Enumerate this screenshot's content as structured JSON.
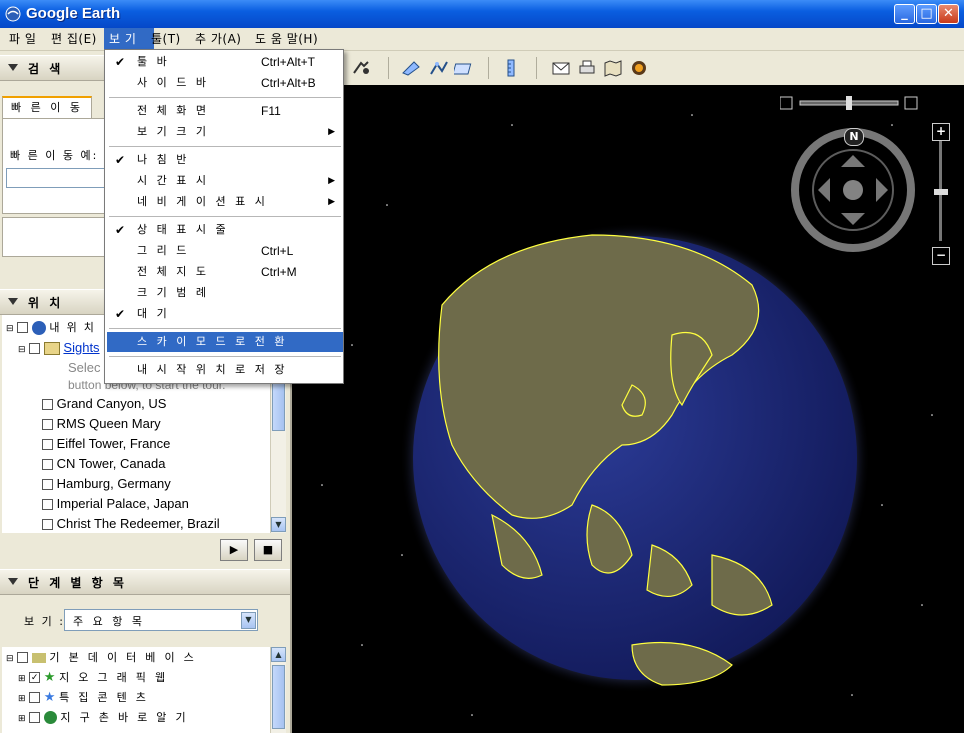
{
  "window": {
    "title": "Google Earth"
  },
  "menubar": {
    "items": [
      "파 일",
      "편 집(E)",
      "보 기",
      "툴(T)",
      "추 가(A)",
      "도 움 말(H)"
    ]
  },
  "view_menu": {
    "items": [
      {
        "label": "툴 바",
        "checked": "✔",
        "shortcut": "Ctrl+Alt+T"
      },
      {
        "label": "사 이 드 바",
        "checked": "",
        "shortcut": "Ctrl+Alt+B"
      },
      {
        "label": "전 체 화 면",
        "checked": "",
        "shortcut": "F11"
      },
      {
        "label": "보 기 크 기",
        "checked": "",
        "submenu": "▶"
      },
      {
        "label": "나 침 반",
        "checked": "✔",
        "shortcut": ""
      },
      {
        "label": "시 간 표 시",
        "checked": "",
        "submenu": "▶"
      },
      {
        "label": "네 비 게 이 션 표 시",
        "checked": "",
        "submenu": "▶"
      },
      {
        "label": "상 태 표 시 줄",
        "checked": "✔",
        "shortcut": ""
      },
      {
        "label": "그 리 드",
        "checked": "",
        "shortcut": "Ctrl+L"
      },
      {
        "label": "전 체 지 도",
        "checked": "",
        "shortcut": "Ctrl+M"
      },
      {
        "label": "크 기 범 례",
        "checked": "",
        "shortcut": ""
      },
      {
        "label": "대 기",
        "checked": "✔",
        "shortcut": ""
      },
      {
        "label": "스 카 이 모 드 로 전 환",
        "checked": "",
        "shortcut": ""
      },
      {
        "label": "내 시 작 위 치 로 저 장",
        "checked": "",
        "shortcut": ""
      }
    ]
  },
  "search_panel": {
    "header": "검 색",
    "tab_label": "빠 른 이 동",
    "prompt": "빠 른 이 동 예: 3"
  },
  "places_panel": {
    "header": "위 치",
    "my_places": "내 위 치",
    "sightseeing": "Sights",
    "desc_line1": "Selec",
    "desc_line2": "button below, to start the tour.",
    "items": [
      "Grand Canyon, US",
      "RMS Queen Mary",
      "Eiffel Tower, France",
      "CN Tower, Canada",
      "Hamburg, Germany",
      "Imperial Palace, Japan",
      "Christ The Redeemer, Brazil"
    ],
    "play_icon": "play-icon",
    "stop_icon": "stop-icon"
  },
  "layers_panel": {
    "header": "단 계 별 항 목",
    "view_label": "보 기 :",
    "view_select": "주 요 항 목",
    "items": [
      "기 본 데 이 터 베 이 스",
      "지 오 그 래 픽 웹",
      "특 집 콘 텐 츠",
      "지 구 촌 바 로 알 기"
    ]
  },
  "nav": {
    "north": "N",
    "zoom_in": "+",
    "zoom_out": "−"
  },
  "colors": {
    "title_bar": "#0a5ee0",
    "menu_highlight": "#316ac5",
    "border_overlay": "#ffff40",
    "ocean": "#1e2a78"
  }
}
